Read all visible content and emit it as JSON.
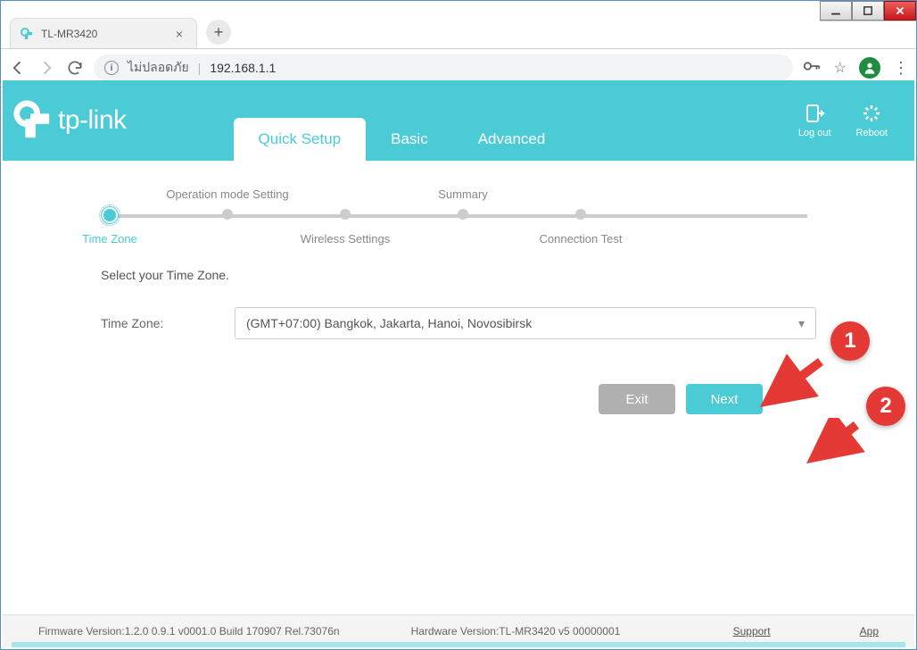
{
  "window": {
    "tab_title": "TL-MR3420"
  },
  "addressbar": {
    "security_text": "ไม่ปลอดภัย",
    "url": "192.168.1.1"
  },
  "header": {
    "brand": "tp-link",
    "tabs": {
      "quick_setup": "Quick Setup",
      "basic": "Basic",
      "advanced": "Advanced"
    },
    "actions": {
      "logout": "Log out",
      "reboot": "Reboot"
    }
  },
  "stepper": {
    "s1": "Time Zone",
    "s2": "Operation mode Setting",
    "s3": "Wireless Settings",
    "s4": "Summary",
    "s5": "Connection Test"
  },
  "form": {
    "instruction": "Select your Time Zone.",
    "label": "Time Zone:",
    "value": "(GMT+07:00) Bangkok, Jakarta, Hanoi, Novosibirsk"
  },
  "buttons": {
    "exit": "Exit",
    "next": "Next"
  },
  "footer": {
    "fw": "Firmware Version:1.2.0 0.9.1 v0001.0 Build 170907 Rel.73076n",
    "hw": "Hardware Version:TL-MR3420 v5 00000001",
    "support": "Support",
    "app": "App"
  },
  "annotations": {
    "a1": "1",
    "a2": "2"
  }
}
